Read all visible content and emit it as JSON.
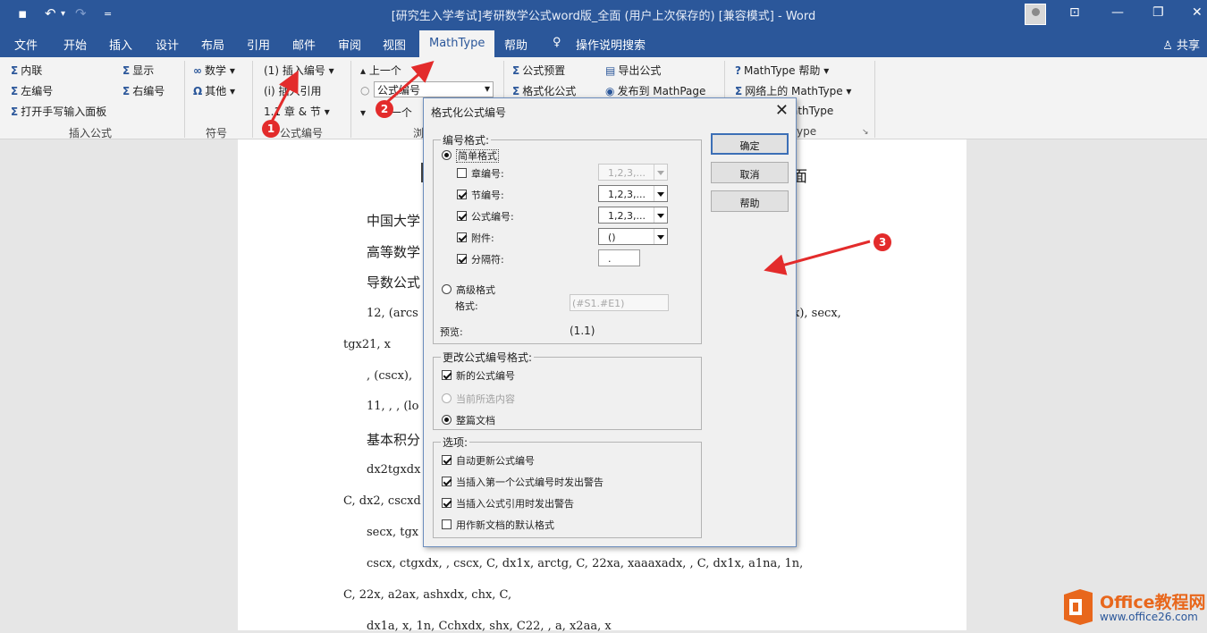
{
  "window": {
    "title": "[研究生入学考试]考研数学公式word版_全面 (用户上次保存的) [兼容模式]  -  Word"
  },
  "quick_access": {
    "save_icon": "save-icon",
    "undo": "↶",
    "redo": "↷",
    "customize": "="
  },
  "menu_tabs": [
    "文件",
    "开始",
    "插入",
    "设计",
    "布局",
    "引用",
    "邮件",
    "审阅",
    "视图",
    "MathType",
    "帮助",
    "操作说明搜索"
  ],
  "share_label": "共享",
  "ribbon": {
    "insert_inline": "内联",
    "insert_left": "左编号",
    "insert_display": "显示",
    "insert_right": "右编号",
    "open_handwriting": "打开手写输入面板",
    "group_insert_formula": "插入公式",
    "math": "数学",
    "other": "其他",
    "group_symbols": "符号",
    "insert_number": "插入编号",
    "insert_ref": "插入引用",
    "chapter_section": "章 & 节",
    "group_formula_number": "公式编号",
    "prev": "上一个",
    "number_combo": "公式编号",
    "next": "一个",
    "group_browse_partial": "浏",
    "formula_preset": "公式预置",
    "format_formula": "格式化公式",
    "export_formula": "导出公式",
    "publish_mathpage": "发布到 MathPage",
    "mathtype_help": "MathType 帮助",
    "mathtype_online": "网络上的 MathType",
    "mathtype_partial1": "athType",
    "mathtype_partial2": "ype"
  },
  "document": {
    "title_partial": "面",
    "lines": [
      "中国大学",
      "高等数学",
      "导数公式",
      "12, (arcs",
      "x), secx,",
      "tgx21, x",
      ", (cscx),",
      "11, , , (lo",
      "基本积分",
      "dx2tgxdx",
      "C, dx2, cscxd",
      "secx, tgx",
      "cscx, ctgxdx, , cscx,  C, dx1x, arctg,  C, 22xa,  xaaaxadx, ,  C, dx1x, a1na, 1n,",
      "C, 22x, a2ax,  ashxdx, chx,  C, ",
      "dx1a,  x, 1n,  Cchxdx, shx,  C22, , a, x2aa, x"
    ]
  },
  "dialog": {
    "title": "格式化公式编号",
    "group_number_format": "编号格式:",
    "simple_format": "简单格式",
    "chapter_number": "章编号:",
    "chapter_value": "1,2,3,...",
    "section_number": "节编号:",
    "section_value": "1,2,3,...",
    "formula_number": "公式编号:",
    "formula_value": "1,2,3,...",
    "enclosure": "附件:",
    "enclosure_value": "()",
    "separator": "分隔符:",
    "separator_value": ".",
    "advanced_format": "高级格式",
    "format_label": "格式:",
    "format_value": "(#S1.#E1)",
    "preview_label": "预览:",
    "preview_value": "(1.1)",
    "group_change": "更改公式编号格式:",
    "new_numbers": "新的公式编号",
    "current_selection": "当前所选内容",
    "whole_document": "整篇文档",
    "group_options": "选项:",
    "auto_update": "自动更新公式编号",
    "warn_first": "当插入第一个公式编号时发出警告",
    "warn_ref": "当插入公式引用时发出警告",
    "default_new": "用作新文档的默认格式",
    "ok": "确定",
    "cancel": "取消",
    "help": "帮助"
  },
  "annotations": {
    "badge1": "1",
    "badge2": "2",
    "badge3": "3",
    "arrow_color": "#e32b2b"
  },
  "watermark": {
    "line1": "Office教程网",
    "line2": "www.office26.com"
  },
  "colors": {
    "accent": "#2b579a",
    "ribbon_bg": "#f3f3f3",
    "marker": "#e32b2b"
  }
}
